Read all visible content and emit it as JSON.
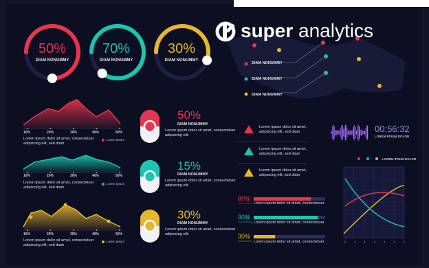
{
  "colors": {
    "red": "#e8344e",
    "teal": "#19c6b2",
    "yellow": "#e6b62c",
    "bg": "#0c0e21",
    "purple": "#8a4ee0"
  },
  "brand": {
    "logo_letter": "k",
    "title_bold": "super",
    "title_light": " analytics"
  },
  "rings": [
    {
      "value": "50%",
      "label": "DIAM NONUMMY",
      "color": "#e8344e",
      "progress": 0.75
    },
    {
      "value": "70%",
      "label": "DIAM NONUMMY",
      "color": "#19c6b2",
      "progress": 0.85
    },
    {
      "value": "30%",
      "label": "DIAM NONUMMY",
      "color": "#e6b62c",
      "progress": 0.55
    }
  ],
  "area_charts": [
    {
      "ticks": [
        "10%",
        "20%",
        "30%",
        "40%",
        "50%"
      ],
      "caption": "Lorem ipsum dolor sit amet, consectetuer adipiscing elit, sed diam",
      "legend": "Lorem ipsum",
      "color": "#e8344e"
    },
    {
      "ticks": [
        "10%",
        "20%",
        "30%",
        "40%",
        "50%"
      ],
      "caption": "Lorem ipsum dolor sit amet, consectetuer adipiscing elit, sed diam",
      "legend": "Lorem ipsum",
      "color": "#19c6b2"
    },
    {
      "ticks": [
        "10%",
        "20%",
        "30%",
        "40%",
        "50%"
      ],
      "caption": "Lorem ipsum dolor sit amet, consectetuer adipiscing elit, sed diam",
      "legend": "Lorem ipsum",
      "color": "#e6b62c"
    }
  ],
  "toggles": [
    {
      "value": "50%",
      "label": "DIAM NONUMMY",
      "text": "Lorem ipsum dolor sit amet, consectetuer adipiscing elit.",
      "color": "#e8344e"
    },
    {
      "value": "15%",
      "label": "DIAM NONUMMY",
      "text": "Lorem ipsum dolor sit amet, consectetuer adipiscing elit.",
      "color": "#19c6b2"
    },
    {
      "value": "30%",
      "label": "DIAM NONUMMY",
      "text": "Lorem ipsum dolor sit amet, consectetuer adipiscing elit.",
      "color": "#e6b62c"
    }
  ],
  "map_labels": [
    "DIAM NONUMMY",
    "DIAM NONUMMY",
    "DIAM NONUMMY"
  ],
  "triangles": [
    {
      "text": "Lorem ipsum dolor sit amet, adipiscing elit, sed diam",
      "color": "#e8344e"
    },
    {
      "text": "Lorem ipsum dolor sit amet, adipiscing elit, sed diam",
      "color": "#19c6b2"
    },
    {
      "text": "Lorem ipsum dolor sit amet, adipiscing elit, sed diam",
      "color": "#e6b62c"
    }
  ],
  "timer": {
    "time": "00:56:32",
    "caption": "LOREM IPSUM DOLOR"
  },
  "graph": {
    "legend": "LOREM IPSUM DOLOR"
  },
  "bars": [
    {
      "value": "80%",
      "caption": "Lorem ipsum dolor sit amet, consectetuer",
      "color": "#e8344e",
      "fill": 0.8
    },
    {
      "value": "90%",
      "caption": "Lorem ipsum dolor sit amet, consectetuer",
      "color": "#19c6b2",
      "fill": 0.9
    },
    {
      "value": "30%",
      "caption": "Lorem ipsum dolor sit amet, consectetuer",
      "color": "#e6b62c",
      "fill": 0.3
    }
  ]
}
